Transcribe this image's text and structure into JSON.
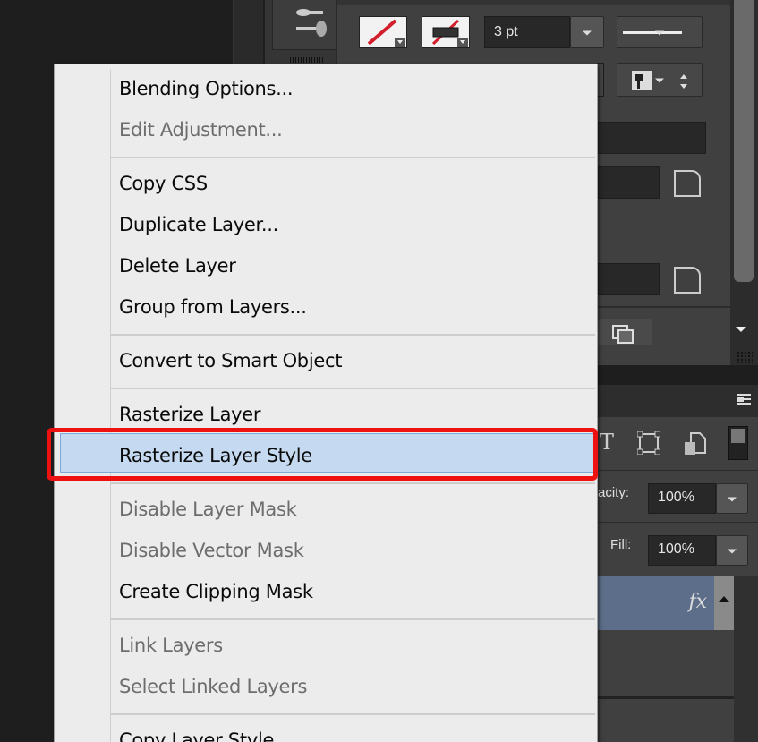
{
  "properties_panel": {
    "stroke_width_value": "3 pt",
    "stroke_color": "#d21f2b",
    "icons": [
      "fill-swatch",
      "stroke-swatch",
      "stroke-style-dropdown",
      "align-stroke-dropdown",
      "corner-radius-icon",
      "corner-radius-icon",
      "path-operations-icon"
    ]
  },
  "layers_panel": {
    "opacity_label": "acity:",
    "opacity_value": "100%",
    "fill_label": "Fill:",
    "fill_value": "100%",
    "layer_fx": "fx",
    "selected_layer_color": "#5d6e8a"
  },
  "context_menu": {
    "highlight_color": "#c5daf0",
    "annotation_color": "#ee1111",
    "items": [
      {
        "label": "Blending Options...",
        "enabled": true
      },
      {
        "label": "Edit Adjustment...",
        "enabled": false
      },
      {
        "label": "Copy CSS",
        "enabled": true
      },
      {
        "label": "Duplicate Layer...",
        "enabled": true
      },
      {
        "label": "Delete Layer",
        "enabled": true
      },
      {
        "label": "Group from Layers...",
        "enabled": true
      },
      {
        "label": "Convert to Smart Object",
        "enabled": true
      },
      {
        "label": "Rasterize Layer",
        "enabled": true
      },
      {
        "label": "Rasterize Layer Style",
        "enabled": true,
        "highlighted": true
      },
      {
        "label": "Disable Layer Mask",
        "enabled": false
      },
      {
        "label": "Disable Vector Mask",
        "enabled": false
      },
      {
        "label": "Create Clipping Mask",
        "enabled": true
      },
      {
        "label": "Link Layers",
        "enabled": false
      },
      {
        "label": "Select Linked Layers",
        "enabled": false
      },
      {
        "label": "Copy Layer Style",
        "enabled": true
      }
    ]
  }
}
